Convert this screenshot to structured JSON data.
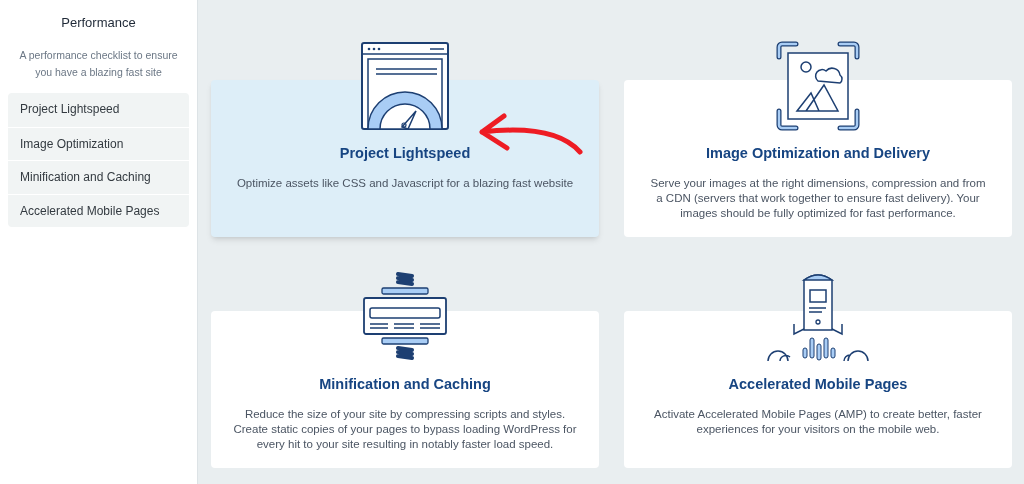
{
  "sidebar": {
    "title": "Performance",
    "subtitle": "A performance checklist to ensure you have a blazing fast site",
    "items": [
      {
        "label": "Project Lightspeed"
      },
      {
        "label": "Image Optimization"
      },
      {
        "label": "Minification and Caching"
      },
      {
        "label": "Accelerated Mobile Pages"
      }
    ]
  },
  "cards": [
    {
      "kind": "gauge",
      "title": "Project Lightspeed",
      "description": "Optimize assets like CSS and Javascript for a blazing fast website",
      "selected": true
    },
    {
      "kind": "image",
      "title": "Image Optimization and Delivery",
      "description": "Serve your images at the right dimensions, compression and from a CDN (servers that work together to ensure fast delivery). Your images should be fully optimized for fast performance.",
      "selected": false
    },
    {
      "kind": "compress",
      "title": "Minification and Caching",
      "description": "Reduce the size of your site by compressing scripts and styles. Create static copies of your pages to bypass loading WordPress for every hit to your site resulting in notably faster load speed.",
      "selected": false
    },
    {
      "kind": "rocket",
      "title": "Accelerated Mobile Pages",
      "description": "Activate Accelerated Mobile Pages (AMP) to create better, faster experiences for your visitors on the mobile web.",
      "selected": false
    }
  ]
}
